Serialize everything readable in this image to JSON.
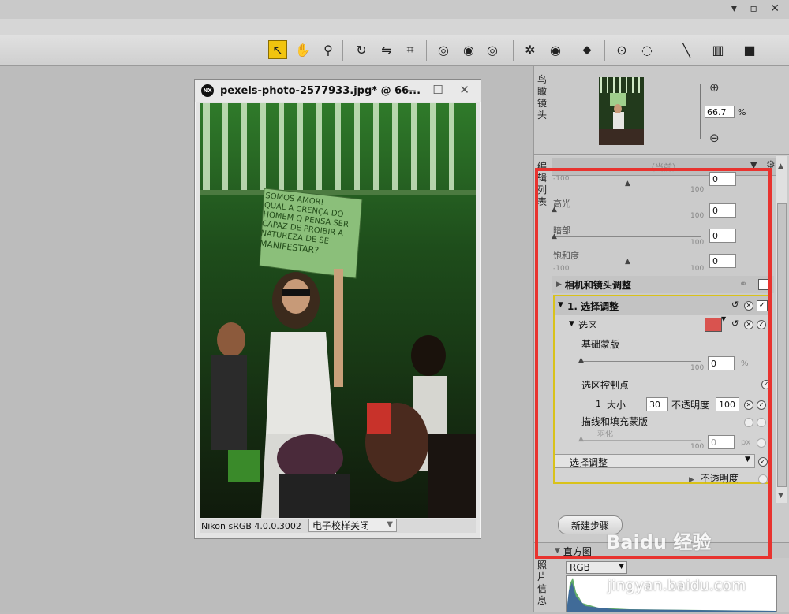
{
  "window_controls": "▾ ▫ ✕",
  "toolbar": {
    "tools": [
      {
        "name": "direct-select-tool-icon",
        "glyph": "↖",
        "active": true
      },
      {
        "name": "hand-tool-icon",
        "glyph": "✋"
      },
      {
        "name": "zoom-tool-icon",
        "glyph": "⚲"
      },
      {
        "name": "rotate-tool-icon",
        "glyph": "↻"
      },
      {
        "name": "straighten-tool-icon",
        "glyph": "⇋"
      },
      {
        "name": "crop-tool-icon",
        "glyph": "⌗"
      },
      {
        "name": "red-eye-tool-icon",
        "glyph": "◎"
      },
      {
        "name": "color-picker-icon",
        "glyph": "◉"
      },
      {
        "name": "gray-point-icon",
        "glyph": "◎"
      },
      {
        "name": "auto-retouch-icon",
        "glyph": "✲"
      },
      {
        "name": "view-icon",
        "glyph": "◉"
      },
      {
        "name": "tag-icon",
        "glyph": "⬥"
      },
      {
        "name": "control-point-icon",
        "glyph": "⊙"
      },
      {
        "name": "lasso-icon",
        "glyph": "◌"
      },
      {
        "name": "brush-icon",
        "glyph": "╲"
      },
      {
        "name": "gradient-icon",
        "glyph": "▥"
      },
      {
        "name": "fill-icon",
        "glyph": "■"
      }
    ]
  },
  "image_window": {
    "title": "pexels-photo-2577933.jpg*  @  66...",
    "icon_text": "NX",
    "buttons": "— ☐ ✕",
    "color_profile": "Nikon sRGB 4.0.0.3002",
    "softproof": "电子校样关闭",
    "sign_lines": [
      "SOMOS AMOR!",
      "QUAL A CRENÇA DO",
      "HOMEM Q PENSA SER",
      "CAPAZ DE PROIBIR A",
      "NATUREZA DE SE",
      "MANIFESTAR?"
    ]
  },
  "birdseye": {
    "label": [
      "鸟",
      "瞰",
      "镜",
      "头"
    ],
    "zoom_value": "66.7",
    "zoom_unit": "%"
  },
  "edit_list": {
    "label": [
      "编",
      "辑",
      "列",
      "表"
    ],
    "header_text": "（当前）",
    "sliders": [
      {
        "label": "",
        "value": "0",
        "min": "-100",
        "max": "100",
        "pos": 0.5
      },
      {
        "label": "高光",
        "value": "0",
        "min": "",
        "max": "100",
        "pos": 0.0
      },
      {
        "label": "暗部",
        "value": "0",
        "min": "",
        "max": "100",
        "pos": 0.0
      },
      {
        "label": "饱和度",
        "value": "0",
        "min": "-100",
        "max": "100",
        "pos": 0.5
      }
    ],
    "camera_lens": "相机和镜头调整",
    "adjust": "调整",
    "step_title": "1. 选择调整",
    "selection": "选区",
    "base_mask": "基础蒙版",
    "base_mask_value": "0",
    "base_mask_unit": "%",
    "base_mask_max": "100",
    "control_points": "选区控制点",
    "cp_index": "1",
    "cp_size_label": "大小",
    "cp_size": "30",
    "cp_opacity_label": "不透明度",
    "cp_opacity": "100",
    "stroke_fill": "描线和填充蒙版",
    "feather": "羽化",
    "feather_value": "0",
    "feather_unit": "px",
    "feather_max": "100",
    "select_adjust": "选择调整",
    "opacity": "不透明度",
    "new_step": "新建步骤"
  },
  "histogram": {
    "title": "直方图",
    "channel": "RGB",
    "photo_info_label": [
      "照",
      "片",
      "信",
      "息"
    ]
  },
  "watermark": {
    "brand": "Baidu 经验",
    "url": "jingyan.baidu.com"
  },
  "colors": {
    "highlight_box": "#e8332f",
    "active_tool": "#f1c40f",
    "step_border": "#d9c21a"
  }
}
